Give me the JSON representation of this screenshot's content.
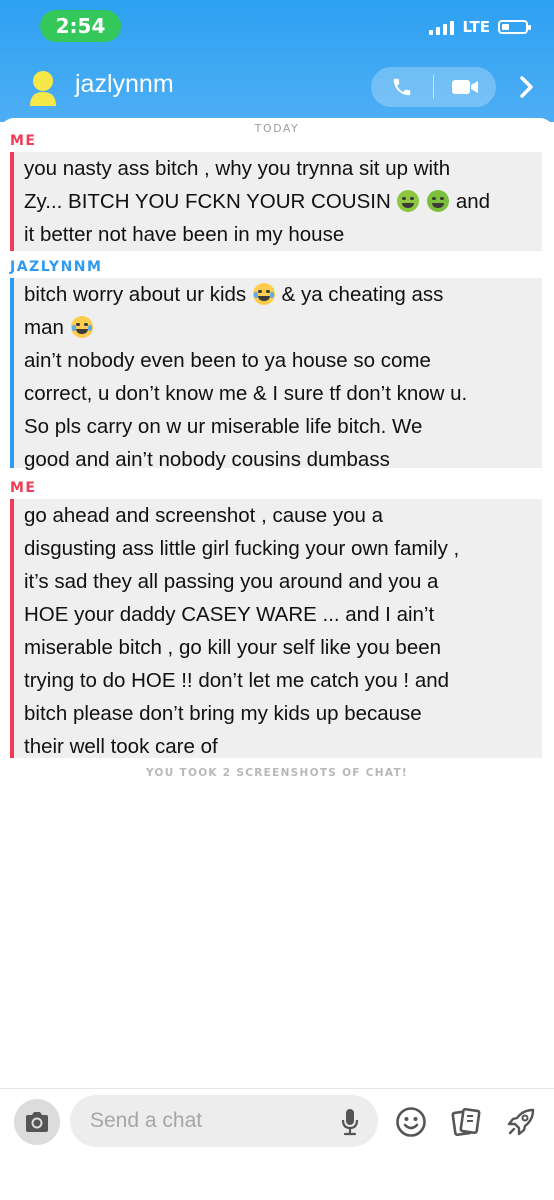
{
  "status_bar": {
    "time": "2:54",
    "network": "LTE"
  },
  "header": {
    "username": "jazlynnm",
    "icons": [
      "avatar-icon",
      "phone-icon",
      "video-icon",
      "chevron-right-icon"
    ]
  },
  "chat": {
    "date_label": "TODAY",
    "messages": [
      {
        "sender": "ME",
        "color": "#f23c57",
        "lines": [
          "you nasty ass bitch , why you trynna sit up with",
          "Zy... BITCH YOU FCKN YOUR COUSIN",
          "and",
          "it better not have been in my house"
        ]
      },
      {
        "sender": "JAZLYNNM",
        "color": "#2f9bf0",
        "lines": [
          "bitch worry about ur kids",
          "& ya cheating ass",
          "man",
          "ain’t nobody even been to ya house so come",
          "correct, u don’t know me & I sure tf don’t know u.",
          "So pls carry on w ur miserable life bitch. We",
          "good and ain’t nobody cousins dumbass"
        ]
      },
      {
        "sender": "ME",
        "color": "#f23c57",
        "lines": [
          "go ahead and screenshot , cause you a",
          "disgusting ass little girl fucking your own family ,",
          "it’s sad they all passing you around and you a",
          "HOE your daddy CASEY WARE ... and I ain’t",
          "miserable bitch , go kill your self like you been",
          "trying to do HOE !! don’t let me catch you ! and",
          "bitch please don’t bring my kids up because",
          "their well took care of"
        ]
      }
    ],
    "system_note": "YOU TOOK 2 SCREENSHOTS OF CHAT!"
  },
  "composer": {
    "placeholder": "Send a chat",
    "value": "",
    "icons": [
      "camera-icon",
      "microphone-icon",
      "smiley-icon",
      "stickers-icon",
      "rocket-icon"
    ]
  }
}
